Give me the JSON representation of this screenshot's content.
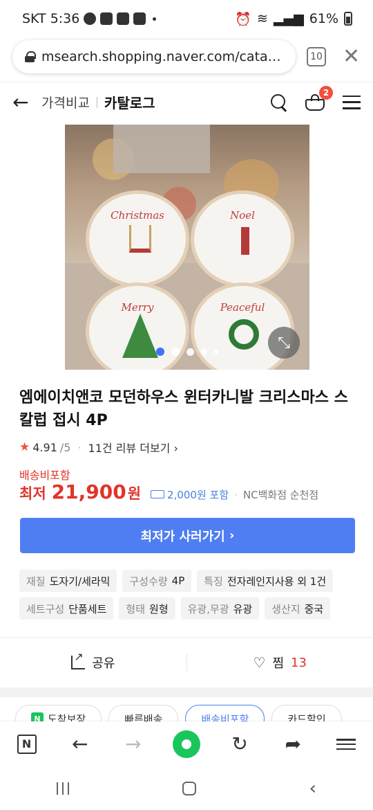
{
  "status": {
    "carrier_time": "SKT 5:36",
    "battery": "61%"
  },
  "browser": {
    "url": "msearch.shopping.naver.com/catalog...",
    "tab_count": "10"
  },
  "header": {
    "compare_label": "가격비교",
    "catalog_label": "카탈로그",
    "cart_badge": "2"
  },
  "product": {
    "plate_words": [
      "Christmas",
      "Noel",
      "Merry",
      "Peaceful"
    ],
    "carousel": {
      "total": 5,
      "active": 1
    },
    "title": "엠에이치앤코 모던하우스 윈터카니발 크리스마스 스칼럽 접시 4P",
    "rating": "4.91",
    "rating_max": "/5",
    "review_text": "11건 리뷰 더보기",
    "shipping_included": "배송비포함",
    "price_label": "최저",
    "price_value": "21,900",
    "price_unit": "원",
    "shipping_fee": "2,000원 포함",
    "store": "NC백화점 순천점",
    "cta_label": "최저가 사러가기"
  },
  "specs": [
    {
      "key": "재질",
      "value": "도자기/세라믹"
    },
    {
      "key": "구성수량",
      "value": "4P"
    },
    {
      "key": "특징",
      "value": "전자레인지사용 외 1건"
    },
    {
      "key": "세트구성",
      "value": "단품세트"
    },
    {
      "key": "형태",
      "value": "원형"
    },
    {
      "key": "유광,무광",
      "value": "유광"
    },
    {
      "key": "생산지",
      "value": "중국"
    }
  ],
  "actions": {
    "share_label": "공유",
    "wish_label": "찜",
    "wish_count": "13"
  },
  "filters": [
    "도착보장",
    "빠른배송",
    "배송비포함",
    "카드할인"
  ],
  "colors": {
    "accent": "#4f7ef2",
    "price_red": "#e0342a",
    "naver_green": "#19c65b"
  }
}
